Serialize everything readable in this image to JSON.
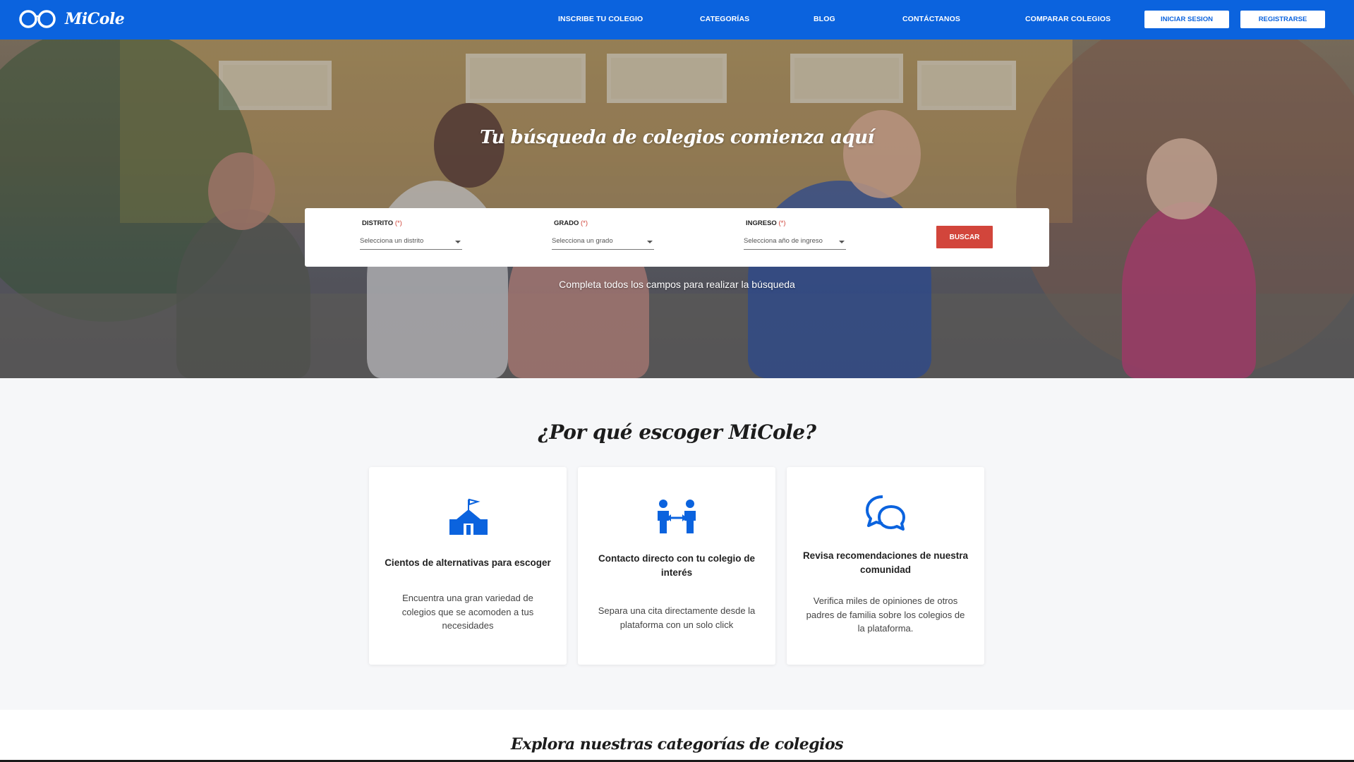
{
  "brand": {
    "name": "MiCole",
    "color": "#0b63de",
    "accent": "#d2453b"
  },
  "nav": {
    "links": [
      "INSCRIBE TU COLEGIO",
      "CATEGORÍAS",
      "BLOG",
      "CONTÁCTANOS",
      "COMPARAR COLEGIOS"
    ],
    "login_label": "INICIAR SESION",
    "register_label": "REGISTRARSE"
  },
  "hero": {
    "title": "Tu búsqueda de colegios comienza aquí",
    "fields": [
      {
        "label": "DISTRITO",
        "required_mark": "(*)",
        "placeholder": "Selecciona un distrito"
      },
      {
        "label": "GRADO",
        "required_mark": "(*)",
        "placeholder": "Selecciona un grado"
      },
      {
        "label": "INGRESO",
        "required_mark": "(*)",
        "placeholder": "Selecciona año de ingreso"
      }
    ],
    "search_label": "BUSCAR",
    "note": "Completa todos los campos para realizar la búsqueda"
  },
  "why": {
    "title": "¿Por qué escoger MiCole?",
    "cards": [
      {
        "icon": "school-icon",
        "title": "Cientos de alternativas para escoger",
        "text": "Encuentra una gran variedad de colegios que se acomoden a tus necesidades"
      },
      {
        "icon": "contact-people-icon",
        "title": "Contacto directo con tu colegio de interés",
        "text": "Separa una cita directamente desde la plataforma con un solo click"
      },
      {
        "icon": "chat-bubbles-icon",
        "title": "Revisa recomendaciones de nuestra comunidad",
        "text": "Verifica miles de opiniones de otros padres de familia sobre los colegios de la plataforma."
      }
    ]
  },
  "categories": {
    "title": "Explora nuestras categorías de colegios"
  }
}
